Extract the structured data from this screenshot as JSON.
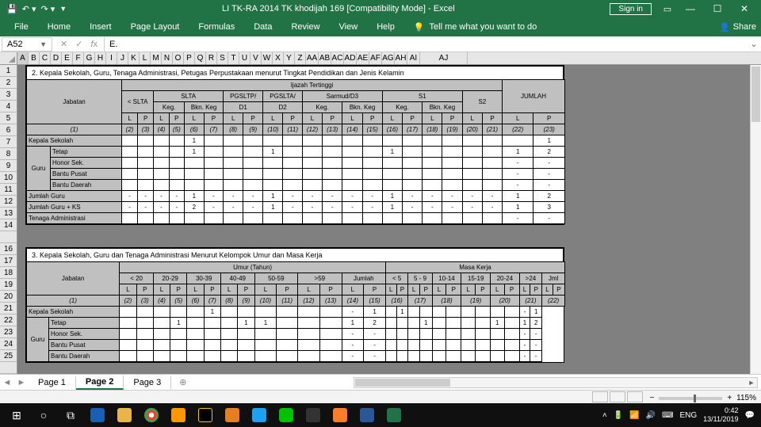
{
  "titlebar": {
    "title": "LI TK-RA 2014 TK khodijah 169  [Compatibility Mode]  -  Excel",
    "signin": "Sign in"
  },
  "ribbon": {
    "tabs": [
      "File",
      "Home",
      "Insert",
      "Page Layout",
      "Formulas",
      "Data",
      "Review",
      "View",
      "Help"
    ],
    "tellme": "Tell me what you want to do",
    "share": "Share"
  },
  "namebox": "A52",
  "formula": "E.",
  "cols": [
    "A",
    "B",
    "C",
    "D",
    "E",
    "F",
    "G",
    "H",
    "I",
    "J",
    "K",
    "L",
    "M",
    "N",
    "O",
    "P",
    "Q",
    "R",
    "S",
    "T",
    "U",
    "V",
    "W",
    "X",
    "Y",
    "Z",
    "AA",
    "AB",
    "AC",
    "AD",
    "AE",
    "AF",
    "AG",
    "AH",
    "AI",
    "AJ"
  ],
  "rows": [
    "1",
    "2",
    "3",
    "4",
    "5",
    "6",
    "7",
    "8",
    "9",
    "10",
    "11",
    "12",
    "13",
    "14",
    "",
    "16",
    "17",
    "18",
    "19",
    "20",
    "21",
    "22",
    "23",
    "24",
    "25",
    ""
  ],
  "section2": {
    "caption": "2.    Kepala Sekolah, Guru, Tenaga Administrasi, Petugas Perpustakaan menurut Tingkat Pendidikan dan Jenis Kelamin",
    "toprow": "Ijazah Tertinggi",
    "jabatan": "Jabatan",
    "groups": [
      "< SLTA",
      "SLTA",
      "PGSLTP/",
      "PGSLTA/",
      "Sarmud/D3",
      "S1",
      "S2",
      "JUMLAH"
    ],
    "sub": [
      "Keg.",
      "Bkn. Keg",
      "D1",
      "D2",
      "Keg.",
      "Bkn. Keg",
      "Keg.",
      "Bkn. Keg"
    ],
    "lp": [
      "L",
      "P",
      "L",
      "P",
      "L",
      "P",
      "L",
      "P",
      "L",
      "P",
      "L",
      "P",
      "L",
      "P",
      "L",
      "P",
      "L",
      "P",
      "L",
      "P",
      "L",
      "P"
    ],
    "nums": [
      "(1)",
      "(2)",
      "(3)",
      "(4)",
      "(5)",
      "(6)",
      "(7)",
      "(8)",
      "(9)",
      "(10)",
      "(11)",
      "(12)",
      "(13)",
      "(14)",
      "(15)",
      "(16)",
      "(17)",
      "(18)",
      "(19)",
      "(20)",
      "(21)",
      "(22)",
      "(23)"
    ],
    "rows": [
      {
        "label": "Kepala Sekolah",
        "sub": "",
        "vals": [
          "",
          "",
          "",
          "",
          "1",
          "",
          "",
          "",
          "",
          "",
          "",
          "",
          "",
          "",
          "",
          "",
          "",
          "",
          "",
          "",
          "",
          "1"
        ]
      },
      {
        "label": "",
        "sub": "Tetap",
        "vals": [
          "",
          "",
          "",
          "",
          "1",
          "",
          "",
          "",
          "1",
          "",
          "",
          "",
          "",
          "",
          "1",
          "",
          "",
          "",
          "",
          "",
          "1",
          "2"
        ]
      },
      {
        "label": "Guru",
        "sub": "Honor Sek.",
        "vals": [
          "",
          "",
          "",
          "",
          "",
          "",
          "",
          "",
          "",
          "",
          "",
          "",
          "",
          "",
          "",
          "",
          "",
          "",
          "",
          "",
          "-",
          "-"
        ]
      },
      {
        "label": "",
        "sub": "Bantu Pusat",
        "vals": [
          "",
          "",
          "",
          "",
          "",
          "",
          "",
          "",
          "",
          "",
          "",
          "",
          "",
          "",
          "",
          "",
          "",
          "",
          "",
          "",
          "-",
          "-"
        ]
      },
      {
        "label": "",
        "sub": "Bantu Daerah",
        "vals": [
          "",
          "",
          "",
          "",
          "",
          "",
          "",
          "",
          "",
          "",
          "",
          "",
          "",
          "",
          "",
          "",
          "",
          "",
          "",
          "",
          "-",
          "-"
        ]
      },
      {
        "label": "Jumlah Guru",
        "sub": "",
        "vals": [
          "-",
          "-",
          "-",
          "-",
          "1",
          "-",
          "-",
          "-",
          "1",
          "-",
          "-",
          "-",
          "-",
          "-",
          "1",
          "-",
          "-",
          "-",
          "-",
          "-",
          "1",
          "2"
        ]
      },
      {
        "label": "Jumlah Guru + KS",
        "sub": "",
        "vals": [
          "-",
          "-",
          "-",
          "-",
          "2",
          "-",
          "-",
          "-",
          "1",
          "-",
          "-",
          "-",
          "-",
          "-",
          "1",
          "-",
          "-",
          "-",
          "-",
          "-",
          "1",
          "3"
        ]
      },
      {
        "label": "Tenaga Administrasi",
        "sub": "",
        "vals": [
          "",
          "",
          "",
          "",
          "",
          "",
          "",
          "",
          "",
          "",
          "",
          "",
          "",
          "",
          "",
          "",
          "",
          "",
          "",
          "",
          "-",
          "-"
        ]
      }
    ]
  },
  "section3": {
    "caption": "3.    Kepala Sekolah, Guru dan Tenaga Administrasi Menurut Kelompok Umur dan Masa Kerja",
    "jabatan": "Jabatan",
    "umur": "Umur (Tahun)",
    "masa": "Masa Kerja",
    "ugroups": [
      "< 20",
      "20-29",
      "30-39",
      "40-49",
      "50-59",
      ">59",
      "Jumlah"
    ],
    "mgroups": [
      "< 5",
      "5 - 9",
      "10-14",
      "15-19",
      "20-24",
      ">24",
      "Jml"
    ],
    "lp": [
      "L",
      "P",
      "L",
      "P",
      "L",
      "P",
      "L",
      "P",
      "L",
      "P",
      "L",
      "P",
      "L",
      "P",
      "L",
      "P",
      "L",
      "P",
      "L",
      "P",
      "L",
      "P",
      "L",
      "P",
      "L",
      "P",
      "L",
      "P"
    ],
    "nums": [
      "(1)",
      "(2)",
      "(3)",
      "(4)",
      "(5)",
      "(6)",
      "(7)",
      "(8)",
      "(9)",
      "(10)",
      "(11)",
      "(12)",
      "(13)",
      "(14)",
      "(15)",
      "(16)",
      "(17)",
      "(18)",
      "(19)",
      "(20)",
      "(21)",
      "(22)"
    ],
    "rows": [
      {
        "label": "Kepala Sekolah",
        "sub": "",
        "vals": [
          "",
          "",
          "",
          "",
          "",
          "1",
          "",
          "",
          "",
          "",
          "",
          "",
          "-",
          "1",
          "",
          "1",
          "",
          "",
          "",
          "",
          "",
          "",
          "",
          "",
          "-",
          "1"
        ]
      },
      {
        "label": "",
        "sub": "Tetap",
        "vals": [
          "",
          "",
          "",
          "1",
          "",
          "",
          "",
          "1",
          "1",
          "",
          "",
          "",
          "1",
          "2",
          "",
          "",
          "",
          "1",
          "",
          "",
          "",
          "",
          "1",
          "",
          "1",
          "2"
        ]
      },
      {
        "label": "Guru",
        "sub": "Honor Sek.",
        "vals": [
          "",
          "",
          "",
          "",
          "",
          "",
          "",
          "",
          "",
          "",
          "",
          "",
          "-",
          "-",
          "",
          "",
          "",
          "",
          "",
          "",
          "",
          "",
          "",
          "",
          "-",
          "-"
        ]
      },
      {
        "label": "",
        "sub": "Bantu Pusat",
        "vals": [
          "",
          "",
          "",
          "",
          "",
          "",
          "",
          "",
          "",
          "",
          "",
          "",
          "-",
          "-",
          "",
          "",
          "",
          "",
          "",
          "",
          "",
          "",
          "",
          "",
          "-",
          "-"
        ]
      },
      {
        "label": "",
        "sub": "Bantu Daerah",
        "vals": [
          "",
          "",
          "",
          "",
          "",
          "",
          "",
          "",
          "",
          "",
          "",
          "",
          "-",
          "-",
          "",
          "",
          "",
          "",
          "",
          "",
          "",
          "",
          "",
          "",
          "-",
          "-"
        ]
      }
    ]
  },
  "sheets": [
    "Page 1",
    "Page 2",
    "Page 3"
  ],
  "statusbar": {
    "zoom": "115%"
  },
  "tray": {
    "lang": "ENG",
    "time": "0:42",
    "date": "13/11/2019"
  }
}
